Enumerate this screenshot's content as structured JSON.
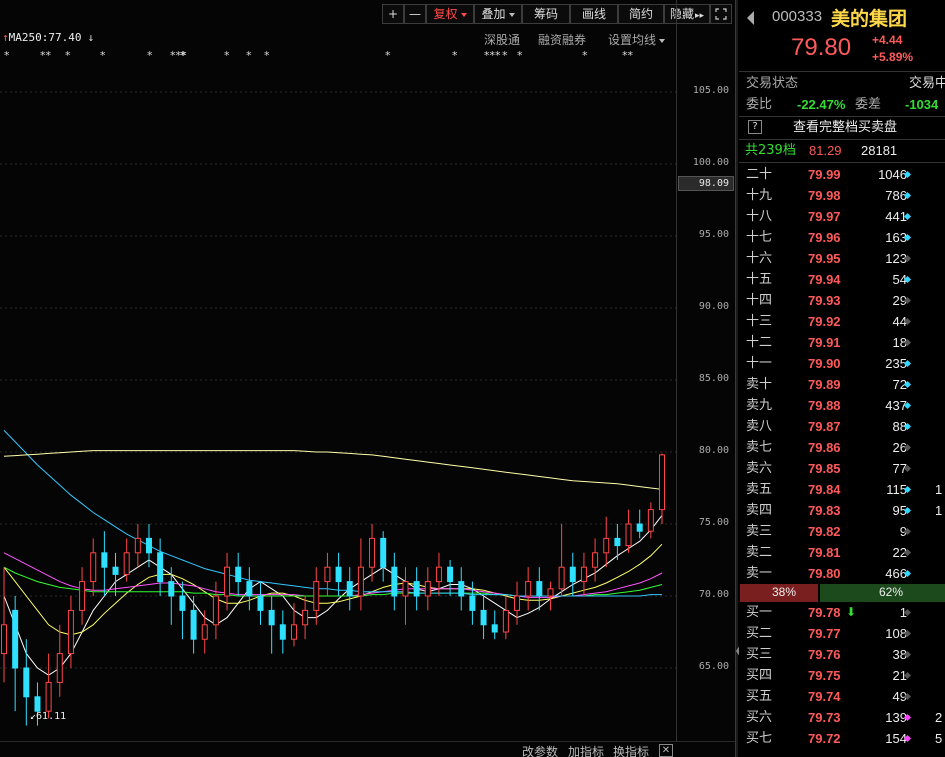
{
  "toolbar": {
    "plus": "+",
    "minus": "—",
    "fuquan": "复权",
    "diejia": "叠加",
    "chouma": "筹码",
    "huaxian": "画线",
    "jianyue": "简约",
    "yincang": "隐藏",
    "yincang_arrows": "▸▸"
  },
  "indicator_header": {
    "ma_text": "MA250:77.40",
    "shengutong": "深股通",
    "rongzi": "融资融券",
    "shezhi_junxian": "设置均线"
  },
  "event_marks": [
    "*",
    "**",
    "*",
    "*",
    "*",
    "***",
    "*",
    "*",
    "*",
    "*",
    "*",
    "*",
    "***",
    "*",
    "*",
    "*",
    "**"
  ],
  "price_axis": {
    "ticks": [
      "105.00",
      "100.00",
      "95.00",
      "90.00",
      "85.00",
      "80.00",
      "75.00",
      "70.00",
      "65.00"
    ],
    "current_label": "98.09",
    "low_label": "61.11"
  },
  "chart_data": {
    "type": "candlestick",
    "ylim": [
      60.5,
      110
    ],
    "candles": [
      [
        66,
        68,
        64,
        72
      ],
      [
        69,
        65,
        62,
        70
      ],
      [
        65,
        63,
        61,
        67
      ],
      [
        63,
        62,
        61,
        64
      ],
      [
        62,
        64,
        61.5,
        66
      ],
      [
        64,
        66,
        63,
        68
      ],
      [
        66,
        69,
        65,
        70
      ],
      [
        69,
        71,
        68,
        72
      ],
      [
        71,
        73,
        70,
        74
      ],
      [
        73,
        72,
        70,
        74.5
      ],
      [
        72,
        71.5,
        70,
        73
      ],
      [
        71.5,
        73,
        71,
        74
      ],
      [
        73,
        74,
        72,
        75
      ],
      [
        74,
        73,
        72,
        75
      ],
      [
        73,
        71,
        70,
        74
      ],
      [
        71,
        70,
        68,
        72
      ],
      [
        70,
        69,
        67,
        71
      ],
      [
        69,
        67,
        66,
        70
      ],
      [
        67,
        68,
        66,
        69
      ],
      [
        68,
        70,
        67,
        71
      ],
      [
        70,
        72,
        69,
        73
      ],
      [
        72,
        71,
        70,
        73
      ],
      [
        71,
        70,
        69,
        72
      ],
      [
        70,
        69,
        68,
        71
      ],
      [
        69,
        68,
        66,
        70
      ],
      [
        68,
        67,
        66,
        69
      ],
      [
        67,
        68,
        66.5,
        69.5
      ],
      [
        68,
        69,
        67,
        70
      ],
      [
        69,
        71,
        68,
        72
      ],
      [
        71,
        72,
        70,
        73
      ],
      [
        72,
        71,
        70,
        73
      ],
      [
        71,
        70,
        69,
        72
      ],
      [
        70,
        72,
        69,
        74
      ],
      [
        72,
        74,
        71,
        75
      ],
      [
        74,
        72,
        71,
        74.5
      ],
      [
        72,
        70,
        69,
        73
      ],
      [
        70,
        71,
        68,
        72
      ],
      [
        71,
        70,
        69,
        72
      ],
      [
        70,
        71,
        69,
        72
      ],
      [
        71,
        72,
        70,
        73
      ],
      [
        72,
        71,
        70,
        72.5
      ],
      [
        71,
        70,
        69,
        72
      ],
      [
        70,
        69,
        68,
        71
      ],
      [
        69,
        68,
        67,
        70
      ],
      [
        68,
        67.5,
        67,
        69
      ],
      [
        67.5,
        69,
        67,
        70
      ],
      [
        69,
        70,
        68,
        71
      ],
      [
        70,
        71,
        69,
        72
      ],
      [
        71,
        70,
        69,
        72
      ],
      [
        70,
        70.5,
        69,
        71
      ],
      [
        70.5,
        72,
        70,
        75
      ],
      [
        72,
        71,
        70,
        73
      ],
      [
        71,
        72,
        70,
        73
      ],
      [
        72,
        73,
        71,
        74
      ],
      [
        73,
        74,
        72,
        75.5
      ],
      [
        74,
        73.5,
        72.5,
        75
      ],
      [
        73.5,
        75,
        73,
        76
      ],
      [
        75,
        74.5,
        74,
        76
      ],
      [
        74.5,
        76,
        74,
        76.5
      ],
      [
        76,
        79.8,
        75,
        79.9
      ]
    ],
    "ma_series": [
      {
        "color": "#ffffff",
        "values": [
          70,
          68,
          66,
          65,
          64.5,
          65,
          66,
          67.5,
          69,
          70,
          71,
          71.5,
          72,
          72.5,
          72,
          71.5,
          70.5,
          69.5,
          68.5,
          68,
          68.5,
          69.5,
          70.5,
          71,
          70.5,
          70,
          69,
          68.5,
          68.5,
          69,
          69.8,
          70.5,
          71,
          71.5,
          72,
          71.5,
          71,
          70.5,
          70.3,
          70.5,
          70.8,
          70.8,
          70.5,
          70,
          69.5,
          69,
          68.5,
          68.8,
          69.2,
          69.8,
          70.3,
          70.8,
          71.2,
          71.6,
          72.2,
          72.8,
          73.3,
          73.8,
          74.6,
          75.6
        ]
      },
      {
        "color": "#ffff66",
        "values": [
          72,
          71,
          70,
          69,
          68,
          67.5,
          67.3,
          67.5,
          68,
          68.8,
          69.5,
          70.2,
          70.8,
          71.3,
          71.5,
          71.5,
          71.2,
          70.8,
          70.3,
          69.8,
          69.5,
          69.5,
          69.7,
          70,
          70.2,
          70.2,
          70,
          69.7,
          69.5,
          69.5,
          69.6,
          69.8,
          70,
          70.3,
          70.6,
          70.8,
          70.9,
          70.8,
          70.6,
          70.5,
          70.5,
          70.5,
          70.5,
          70.4,
          70.2,
          70,
          69.8,
          69.7,
          69.7,
          69.8,
          70,
          70.2,
          70.4,
          70.6,
          70.9,
          71.3,
          71.7,
          72.2,
          72.8,
          73.6
        ]
      },
      {
        "color": "#ff55ff",
        "values": [
          73,
          72.6,
          72.2,
          71.8,
          71.4,
          71,
          70.7,
          70.5,
          70.4,
          70.4,
          70.5,
          70.6,
          70.7,
          70.8,
          70.9,
          70.9,
          70.8,
          70.7,
          70.5,
          70.3,
          70.2,
          70.1,
          70.1,
          70.1,
          70.1,
          70.1,
          70.1,
          70,
          70,
          70,
          70,
          70,
          70.1,
          70.2,
          70.3,
          70.4,
          70.5,
          70.5,
          70.5,
          70.5,
          70.5,
          70.5,
          70.4,
          70.3,
          70.2,
          70.1,
          70,
          69.9,
          69.9,
          69.9,
          70,
          70,
          70.1,
          70.2,
          70.3,
          70.5,
          70.7,
          70.9,
          71.2,
          71.6
        ]
      },
      {
        "color": "#33ff33",
        "values": [
          72,
          71.6,
          71.3,
          71,
          70.8,
          70.6,
          70.5,
          70.4,
          70.3,
          70.3,
          70.3,
          70.3,
          70.3,
          70.3,
          70.3,
          70.3,
          70.3,
          70.2,
          70.2,
          70.1,
          70.1,
          70,
          70,
          70,
          70,
          70,
          70,
          70,
          70,
          70,
          70,
          70,
          70,
          70.1,
          70.1,
          70.2,
          70.2,
          70.2,
          70.2,
          70.2,
          70.2,
          70.2,
          70.2,
          70.2,
          70.1,
          70.1,
          70,
          70,
          70,
          70,
          70,
          70,
          70,
          70.1,
          70.1,
          70.2,
          70.3,
          70.4,
          70.6,
          70.8
        ]
      },
      {
        "color": "#33c8ff",
        "values": [
          81.5,
          80.7,
          79.9,
          79.1,
          78.4,
          77.7,
          77,
          76.4,
          75.8,
          75.3,
          74.8,
          74.3,
          73.9,
          73.5,
          73.1,
          72.8,
          72.5,
          72.2,
          71.9,
          71.7,
          71.5,
          71.3,
          71.1,
          71,
          70.9,
          70.8,
          70.7,
          70.6,
          70.5,
          70.5,
          70.4,
          70.4,
          70.3,
          70.3,
          70.3,
          70.3,
          70.3,
          70.2,
          70.2,
          70.2,
          70.2,
          70.2,
          70.1,
          70.1,
          70.1,
          70.1,
          70,
          70,
          70,
          70,
          70,
          70,
          70,
          70,
          70,
          70,
          70,
          70,
          70.1,
          70.1
        ]
      },
      {
        "color": "#ffffaa",
        "values": [
          79.7,
          79.75,
          79.8,
          79.85,
          79.9,
          79.95,
          80,
          80.05,
          80.1,
          80.1,
          80.1,
          80.1,
          80.1,
          80.1,
          80.1,
          80.1,
          80.1,
          80.1,
          80.1,
          80.1,
          80.1,
          80.1,
          80.1,
          80.1,
          80.1,
          80.1,
          80.1,
          80.05,
          80,
          80,
          79.95,
          79.9,
          79.85,
          79.8,
          79.7,
          79.6,
          79.5,
          79.4,
          79.3,
          79.2,
          79.1,
          79,
          78.9,
          78.8,
          78.7,
          78.6,
          78.5,
          78.4,
          78.3,
          78.2,
          78.1,
          78,
          77.95,
          77.9,
          77.85,
          77.8,
          77.7,
          77.6,
          77.5,
          77.4
        ]
      }
    ]
  },
  "bottom_bar": {
    "gaicanshu": "改参数",
    "jiazhibiao": "加指标",
    "huanzhibiao": "换指标",
    "close": "✕"
  },
  "quote": {
    "code": "000333",
    "name": "美的集团",
    "price": "79.80",
    "change": "+4.44",
    "change_pct": "+5.89%",
    "status_label": "交易状态",
    "status_value": "交易中",
    "weibi_label": "委比",
    "weibi_value": "-22.47%",
    "weicha_label": "委差",
    "weicha_value": "-1034",
    "full_book_q": "?",
    "full_book_text": "查看完整档买卖盘",
    "total_label": "共239档",
    "total_price": "81.29",
    "total_vol": "28181",
    "colors": {
      "up": "#ff5a5a",
      "down": "#33dd33",
      "cyan": "#33d6ff",
      "magenta": "#ff44ff"
    }
  },
  "sell_book": [
    {
      "label": "二十",
      "price": "79.99",
      "vol": "1046",
      "dot": "cyan"
    },
    {
      "label": "十九",
      "price": "79.98",
      "vol": "786",
      "dot": "cyan"
    },
    {
      "label": "十八",
      "price": "79.97",
      "vol": "441",
      "dot": "cyan"
    },
    {
      "label": "十七",
      "price": "79.96",
      "vol": "163",
      "dot": "cyan"
    },
    {
      "label": "十六",
      "price": "79.95",
      "vol": "123",
      "dot": "gray"
    },
    {
      "label": "十五",
      "price": "79.94",
      "vol": "54",
      "dot": "cyan"
    },
    {
      "label": "十四",
      "price": "79.93",
      "vol": "29",
      "dot": "gray"
    },
    {
      "label": "十三",
      "price": "79.92",
      "vol": "44",
      "dot": "gray"
    },
    {
      "label": "十二",
      "price": "79.91",
      "vol": "18",
      "dot": "gray"
    },
    {
      "label": "十一",
      "price": "79.90",
      "vol": "235",
      "dot": "cyan"
    },
    {
      "label": "卖十",
      "price": "79.89",
      "vol": "72",
      "dot": "cyan"
    },
    {
      "label": "卖九",
      "price": "79.88",
      "vol": "437",
      "dot": "cyan"
    },
    {
      "label": "卖八",
      "price": "79.87",
      "vol": "88",
      "dot": "cyan"
    },
    {
      "label": "卖七",
      "price": "79.86",
      "vol": "26",
      "dot": "gray"
    },
    {
      "label": "卖六",
      "price": "79.85",
      "vol": "77",
      "dot": "gray"
    },
    {
      "label": "卖五",
      "price": "79.84",
      "vol": "115",
      "dot": "cyan",
      "extra": "1"
    },
    {
      "label": "卖四",
      "price": "79.83",
      "vol": "95",
      "dot": "cyan",
      "extra": "1"
    },
    {
      "label": "卖三",
      "price": "79.82",
      "vol": "9",
      "dot": "gray"
    },
    {
      "label": "卖二",
      "price": "79.81",
      "vol": "22",
      "dot": "gray"
    },
    {
      "label": "卖一",
      "price": "79.80",
      "vol": "466",
      "dot": "cyan"
    }
  ],
  "ratio_bar": {
    "sell_pct": "38%",
    "buy_pct": "62%",
    "sell_fraction": 0.38
  },
  "buy_book": [
    {
      "label": "买一",
      "price": "79.78",
      "vol": "1",
      "dot": "gray",
      "arrow": "⬇"
    },
    {
      "label": "买二",
      "price": "79.77",
      "vol": "108",
      "dot": "gray"
    },
    {
      "label": "买三",
      "price": "79.76",
      "vol": "38",
      "dot": "gray"
    },
    {
      "label": "买四",
      "price": "79.75",
      "vol": "21",
      "dot": "gray"
    },
    {
      "label": "买五",
      "price": "79.74",
      "vol": "49",
      "dot": "gray"
    },
    {
      "label": "买六",
      "price": "79.73",
      "vol": "139",
      "dot": "magenta",
      "extra": "2"
    },
    {
      "label": "买七",
      "price": "79.72",
      "vol": "154",
      "dot": "magenta",
      "extra": "5"
    }
  ]
}
